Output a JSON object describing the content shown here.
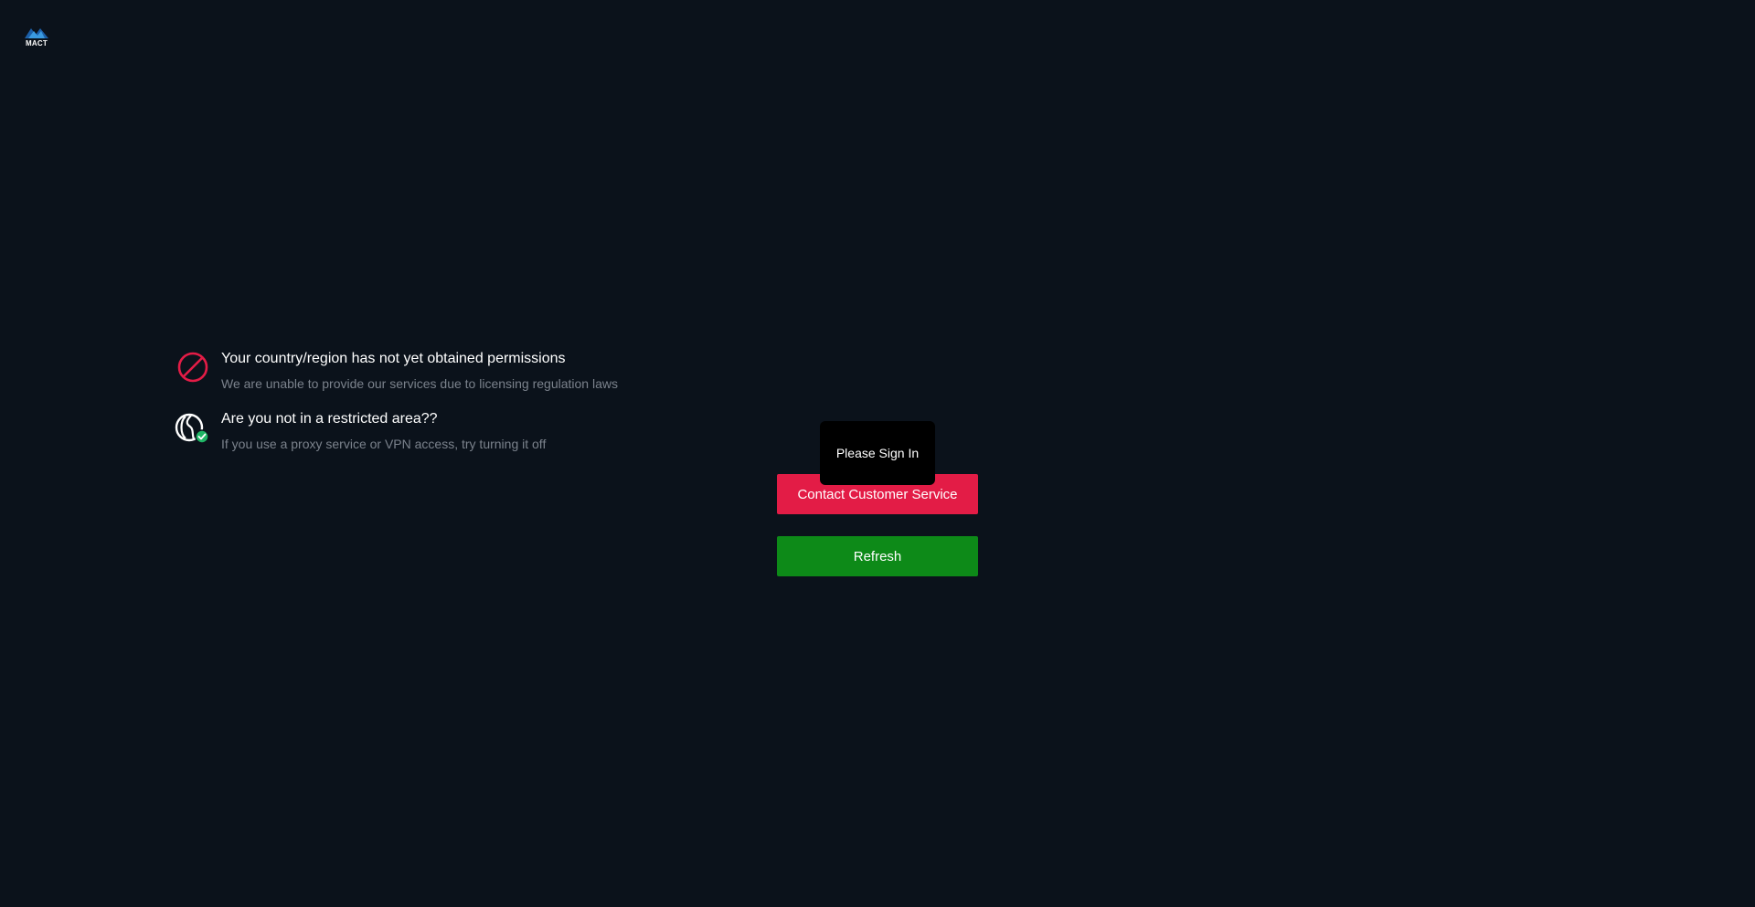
{
  "logo": {
    "text": "MACT",
    "accent_color": "#2f8fd6"
  },
  "notices": [
    {
      "icon": "prohibited-icon",
      "title": "Your country/region has not yet obtained permissions",
      "subtitle": "We are unable to provide our services due to licensing regulation laws"
    },
    {
      "icon": "globe-check-icon",
      "title": "Are you not in a restricted area??",
      "subtitle": "If you use a proxy service or VPN access, try turning it off"
    }
  ],
  "buttons": {
    "contact_label": "Contact Customer Service",
    "refresh_label": "Refresh"
  },
  "tooltip": {
    "text": "Please Sign In"
  },
  "colors": {
    "background": "#0b121b",
    "danger": "#e31c46",
    "success": "#0d8a18",
    "check_badge": "#1fb565"
  }
}
